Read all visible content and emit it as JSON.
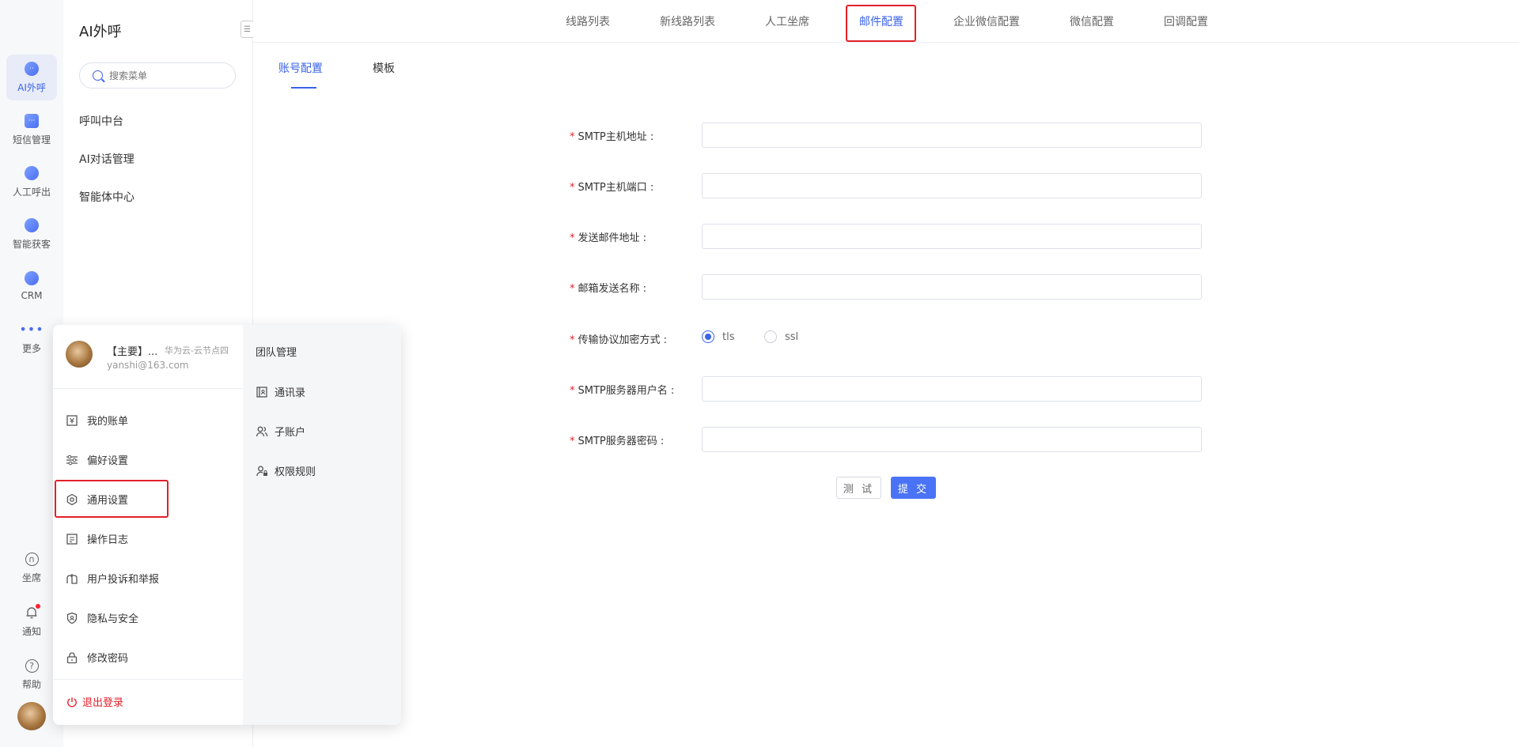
{
  "rail": {
    "items": [
      {
        "label": "AI外呼"
      },
      {
        "label": "短信管理"
      },
      {
        "label": "人工呼出"
      },
      {
        "label": "智能获客"
      },
      {
        "label": "CRM"
      },
      {
        "label": "更多"
      }
    ],
    "bottom": [
      {
        "label": "坐席"
      },
      {
        "label": "通知"
      },
      {
        "label": "帮助"
      }
    ]
  },
  "menu": {
    "title": "AI外呼",
    "search_placeholder": "搜索菜单",
    "items": [
      "呼叫中台",
      "AI对话管理",
      "智能体中心"
    ]
  },
  "top_tabs": [
    "线路列表",
    "新线路列表",
    "人工坐席",
    "邮件配置",
    "企业微信配置",
    "微信配置",
    "回调配置"
  ],
  "sub_tabs": [
    "账号配置",
    "模板"
  ],
  "form": {
    "fields": [
      {
        "label": "SMTP主机地址 :",
        "value": ""
      },
      {
        "label": "SMTP主机端口 :",
        "value": ""
      },
      {
        "label": "发送邮件地址 :",
        "value": ""
      },
      {
        "label": "邮箱发送名称 :",
        "value": ""
      },
      {
        "label": "传输协议加密方式 :"
      },
      {
        "label": "SMTP服务器用户名 :",
        "value": ""
      },
      {
        "label": "SMTP服务器密码 :",
        "value": ""
      }
    ],
    "required_mark": "*",
    "radio_options": [
      "tls",
      "ssl"
    ],
    "radio_selected": "tls",
    "test_label": "测 试",
    "submit_label": "提 交"
  },
  "popup": {
    "account_name": "【主要】...",
    "node": "华为云-云节点四",
    "email": "yanshi@163.com",
    "items": [
      "我的账单",
      "偏好设置",
      "通用设置",
      "操作日志",
      "用户投诉和举报",
      "隐私与安全",
      "修改密码"
    ],
    "logout": "退出登录",
    "team_title": "团队管理",
    "team_items": [
      "通讯录",
      "子账户",
      "权限规则"
    ]
  },
  "colors": {
    "accent": "#3a63e8",
    "highlight": "#e3202a",
    "submit": "#4a74f5"
  }
}
